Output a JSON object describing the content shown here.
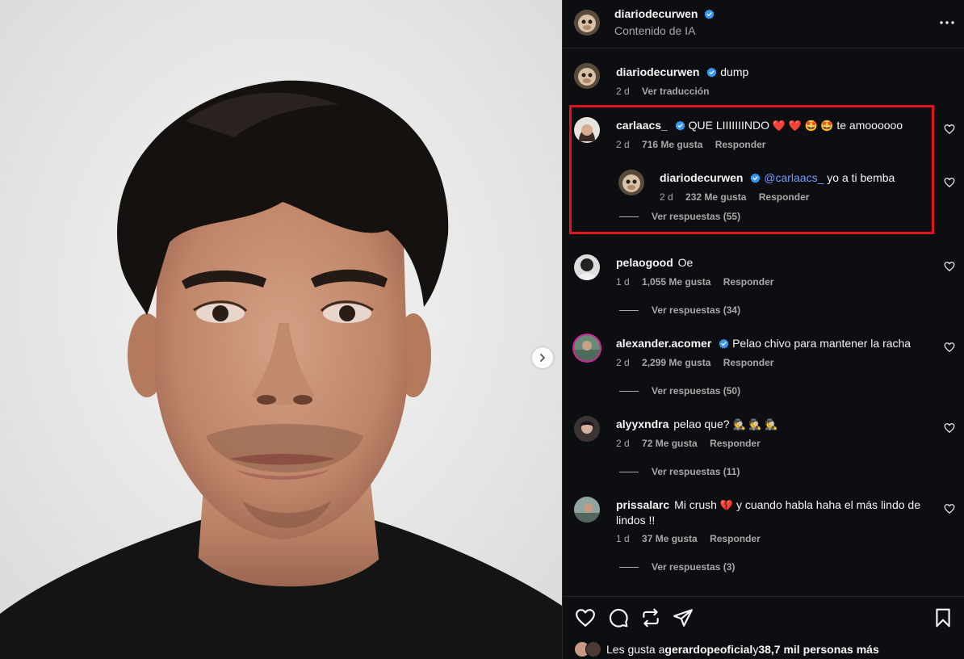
{
  "header": {
    "username": "diariodecurwen",
    "subtitle": "Contenido de IA",
    "more_icon": "more-horizontal-icon"
  },
  "caption": {
    "username": "diariodecurwen",
    "text": "dump",
    "time": "2 d",
    "translate": "Ver traducción"
  },
  "comments": [
    {
      "username": "carlaacs_",
      "text": "QUE LIIIIIIINDO",
      "emojis": "❤️ ❤️ 🤩 🤩",
      "text_after": "te amoooooo",
      "time": "2 d",
      "likes": "716 Me gusta",
      "reply": "Responder"
    },
    {
      "username": "diariodecurwen",
      "mention": "@carlaacs_",
      "text": "yo a ti bemba",
      "time": "2 d",
      "likes": "232 Me gusta",
      "reply": "Responder",
      "view_replies": "Ver respuestas (55)"
    },
    {
      "username": "pelaogood",
      "text": "Oe",
      "time": "1 d",
      "likes": "1,055 Me gusta",
      "reply": "Responder",
      "view_replies": "Ver respuestas (34)"
    },
    {
      "username": "alexander.acomer",
      "text": "Pelao chivo para mantener la racha",
      "time": "2 d",
      "likes": "2,299 Me gusta",
      "reply": "Responder",
      "view_replies": "Ver respuestas (50)"
    },
    {
      "username": "alyyxndra",
      "text": "pelao que?",
      "emojis": "🕵️ 🕵️ 🕵️",
      "time": "2 d",
      "likes": "72 Me gusta",
      "reply": "Responder",
      "view_replies": "Ver respuestas (11)"
    },
    {
      "username": "prissalarc",
      "text": "Mi crush",
      "emojis": "💔",
      "text_after": "y cuando habla haha el más lindo de lindos !!",
      "time": "1 d",
      "likes": "37 Me gusta",
      "reply": "Responder",
      "view_replies": "Ver respuestas (3)"
    }
  ],
  "footer": {
    "likes_prefix": "Les gusta a ",
    "likes_user": "gerardopeoficial",
    "likes_suffix": " y ",
    "likes_count": "38,7 mil personas más"
  },
  "icons": {
    "like": "heart-icon",
    "comment": "comment-icon",
    "repost": "repost-icon",
    "share": "send-icon",
    "save": "bookmark-icon",
    "next": "chevron-right-icon"
  },
  "colors": {
    "panel_bg": "#0c0e11",
    "verified": "#3897f0",
    "highlight": "#e0141e",
    "mention": "#7a9cff"
  }
}
